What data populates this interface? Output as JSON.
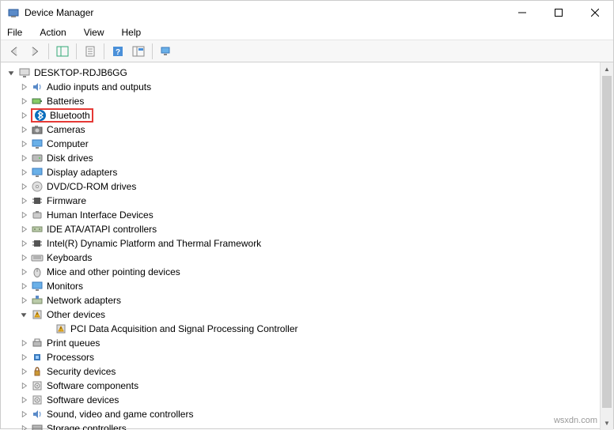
{
  "window": {
    "title": "Device Manager"
  },
  "menubar": {
    "file": "File",
    "action": "Action",
    "view": "View",
    "help": "Help"
  },
  "tree": {
    "root": "DESKTOP-RDJB6GG",
    "items": [
      {
        "label": "Audio inputs and outputs",
        "icon": "audio"
      },
      {
        "label": "Batteries",
        "icon": "battery"
      },
      {
        "label": "Bluetooth",
        "icon": "bluetooth",
        "highlighted": true
      },
      {
        "label": "Cameras",
        "icon": "camera"
      },
      {
        "label": "Computer",
        "icon": "monitor"
      },
      {
        "label": "Disk drives",
        "icon": "disk"
      },
      {
        "label": "Display adapters",
        "icon": "monitor"
      },
      {
        "label": "DVD/CD-ROM drives",
        "icon": "cd"
      },
      {
        "label": "Firmware",
        "icon": "chip"
      },
      {
        "label": "Human Interface Devices",
        "icon": "hid"
      },
      {
        "label": "IDE ATA/ATAPI controllers",
        "icon": "ide"
      },
      {
        "label": "Intel(R) Dynamic Platform and Thermal Framework",
        "icon": "chip"
      },
      {
        "label": "Keyboards",
        "icon": "keyboard"
      },
      {
        "label": "Mice and other pointing devices",
        "icon": "mouse"
      },
      {
        "label": "Monitors",
        "icon": "monitor"
      },
      {
        "label": "Network adapters",
        "icon": "network"
      },
      {
        "label": "Other devices",
        "icon": "warning",
        "expanded": true,
        "children": [
          {
            "label": "PCI Data Acquisition and Signal Processing Controller",
            "icon": "warning"
          }
        ]
      },
      {
        "label": "Print queues",
        "icon": "printer"
      },
      {
        "label": "Processors",
        "icon": "cpu"
      },
      {
        "label": "Security devices",
        "icon": "security"
      },
      {
        "label": "Software components",
        "icon": "software"
      },
      {
        "label": "Software devices",
        "icon": "software"
      },
      {
        "label": "Sound, video and game controllers",
        "icon": "audio"
      },
      {
        "label": "Storage controllers",
        "icon": "storage"
      }
    ]
  },
  "watermark": "wsxdn.com"
}
